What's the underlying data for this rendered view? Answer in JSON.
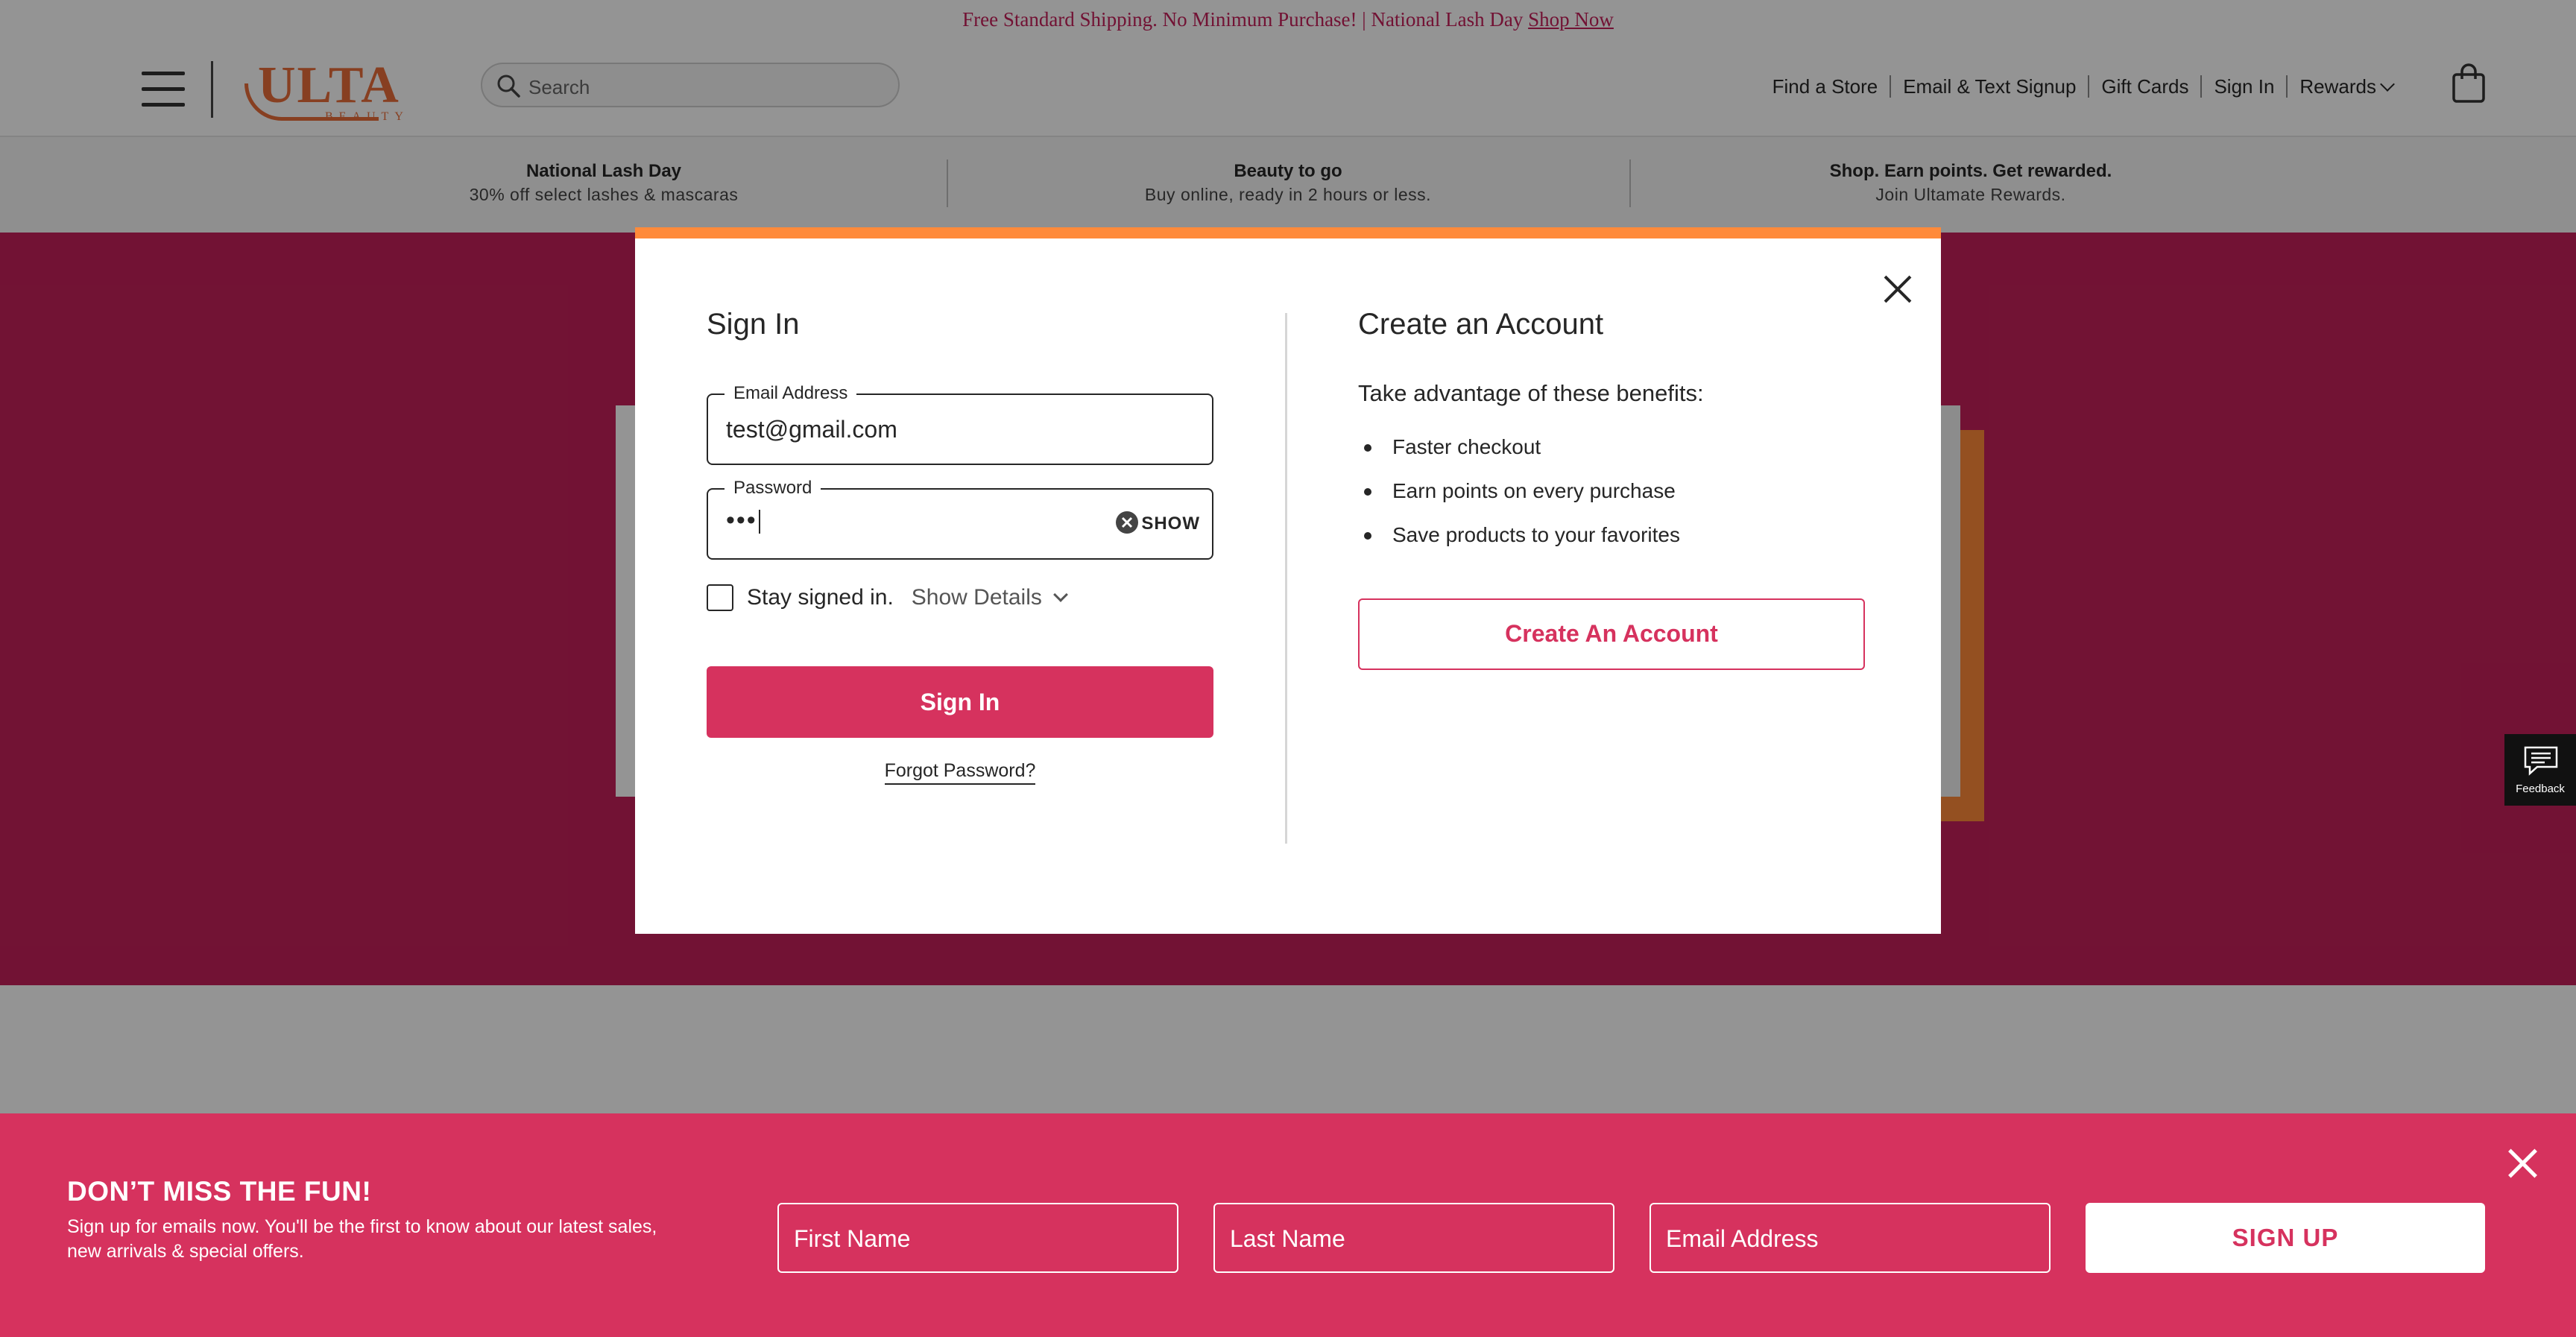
{
  "promo": {
    "text": "Free Standard Shipping. No Minimum Purchase! |  National Lash Day ",
    "link": "Shop Now"
  },
  "header": {
    "logo_text": "ULTA",
    "logo_sub": "BEAUTY",
    "search_placeholder": "Search",
    "utility_nav": [
      "Find a Store",
      "Email & Text Signup",
      "Gift Cards",
      "Sign In",
      "Rewards"
    ]
  },
  "benefits": [
    {
      "title": "National Lash Day",
      "subtitle": "30% off select lashes & mascaras"
    },
    {
      "title": "Beauty to go",
      "subtitle": "Buy online, ready in 2 hours or less."
    },
    {
      "title": "Shop. Earn points. Get rewarded.",
      "subtitle": "Join Ultamate Rewards."
    }
  ],
  "feedback": {
    "label": "Feedback"
  },
  "modal": {
    "signin": {
      "title": "Sign In",
      "email_label": "Email Address",
      "email_value": "test@gmail.com",
      "password_label": "Password",
      "password_masked": "•••",
      "show_label": "SHOW",
      "stay_signed_in": "Stay signed in.",
      "show_details": "Show Details",
      "button": "Sign In",
      "forgot": "Forgot Password?"
    },
    "create": {
      "title": "Create an Account",
      "intro": "Take advantage of these benefits:",
      "benefits": [
        "Faster checkout",
        "Earn points on every purchase",
        "Save products to your favorites"
      ],
      "button": "Create An Account"
    }
  },
  "signup_banner": {
    "title": "DON’T MISS THE FUN!",
    "description": "Sign up for emails now. You'll be the first to know about our latest sales, new arrivals & special offers.",
    "first_name_placeholder": "First Name",
    "last_name_placeholder": "Last Name",
    "email_placeholder": "Email Address",
    "button": "SIGN UP"
  },
  "colors": {
    "brand_pink": "#d6325e",
    "brand_orange": "#ff8a3a",
    "hero_magenta": "#c4205a"
  }
}
